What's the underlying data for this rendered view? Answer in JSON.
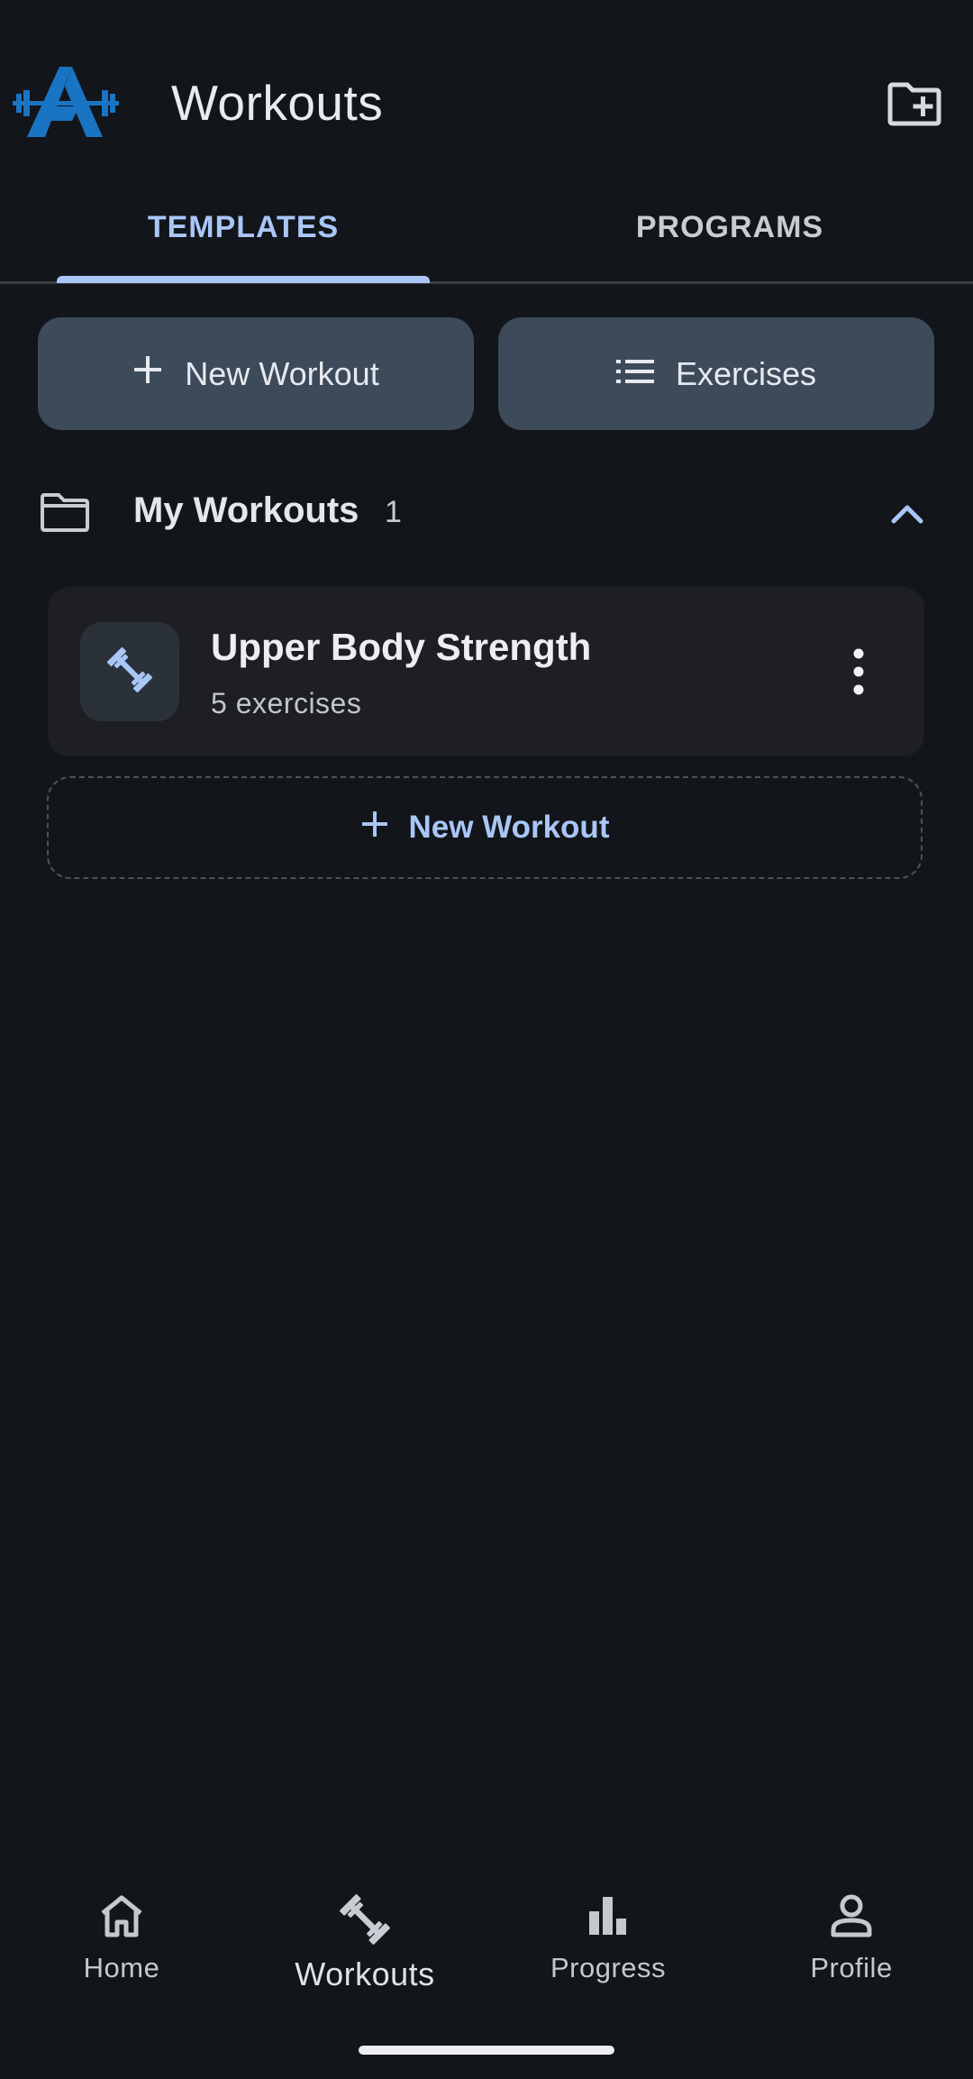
{
  "header": {
    "title": "Workouts",
    "logo_icon": "dumbbell-mountain-logo",
    "add_folder_icon": "folder-plus-icon"
  },
  "tabs": [
    {
      "label": "TEMPLATES",
      "active": true
    },
    {
      "label": "PROGRAMS",
      "active": false
    }
  ],
  "actions": {
    "new_workout_label": "New Workout",
    "exercises_label": "Exercises"
  },
  "section": {
    "title": "My Workouts",
    "count": "1",
    "expanded": true
  },
  "workouts": [
    {
      "name": "Upper Body Strength",
      "subtitle": "5 exercises"
    }
  ],
  "add_workout_label": "New Workout",
  "bottom_nav": [
    {
      "label": "Home",
      "icon": "home-icon"
    },
    {
      "label": "Workouts",
      "icon": "dumbbell-icon",
      "active": true
    },
    {
      "label": "Progress",
      "icon": "bar-chart-icon"
    },
    {
      "label": "Profile",
      "icon": "person-icon"
    }
  ],
  "colors": {
    "background": "#121519",
    "accent": "#a9c6f7",
    "button_bg": "#3d4a5a",
    "card_bg": "#1e1f23",
    "logo_blue": "#1a74c4"
  }
}
